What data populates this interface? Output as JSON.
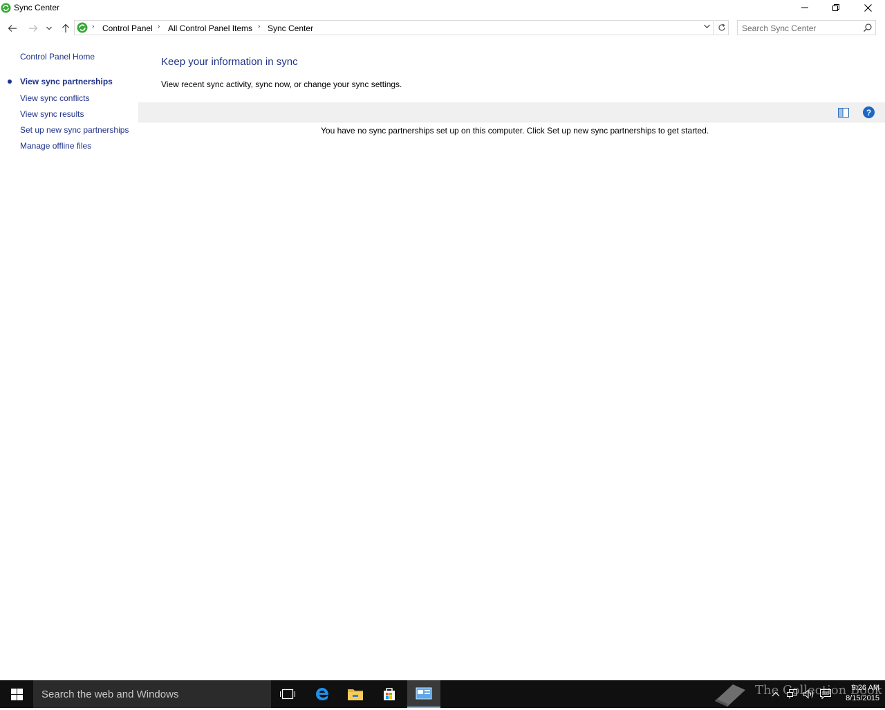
{
  "window": {
    "title": "Sync Center",
    "controls": {
      "minimize": "minimize",
      "maximize": "restore",
      "close": "close"
    }
  },
  "navigation": {
    "breadcrumbs": [
      "Control Panel",
      "All Control Panel Items",
      "Sync Center"
    ],
    "search_placeholder": "Search Sync Center"
  },
  "sidebar": {
    "home": "Control Panel Home",
    "items": [
      {
        "label": "View sync partnerships",
        "active": true
      },
      {
        "label": "View sync conflicts",
        "active": false
      },
      {
        "label": "View sync results",
        "active": false
      },
      {
        "label": "Set up new sync partnerships",
        "active": false
      },
      {
        "label": "Manage offline files",
        "active": false
      }
    ]
  },
  "main": {
    "heading": "Keep your information in sync",
    "description": "View recent sync activity, sync now, or change your sync settings.",
    "empty_message": "You have no sync partnerships set up on this computer. Click Set up new sync partnerships to get started.",
    "help_glyph": "?"
  },
  "taskbar": {
    "search_placeholder": "Search the web and Windows",
    "pinned": [
      "task-view-icon",
      "edge-icon",
      "file-explorer-icon",
      "store-icon",
      "control-panel-icon"
    ],
    "watermark": "The Collection Book",
    "clock": {
      "time": "9:26 AM",
      "date": "8/15/2015"
    }
  },
  "colors": {
    "link": "#1e3287",
    "taskbar": "#101010",
    "toolbar": "#f0f0f0",
    "help": "#1a68c6"
  }
}
